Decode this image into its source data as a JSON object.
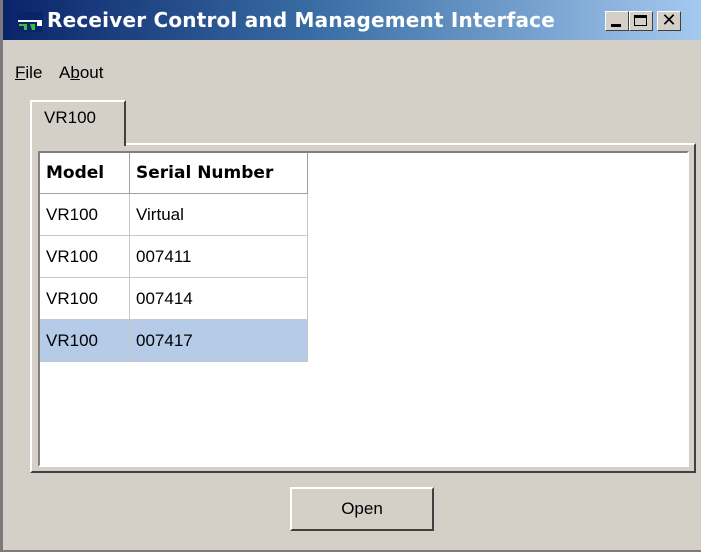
{
  "window": {
    "title": "Receiver Control and Management Interface",
    "icon": "app-icon"
  },
  "menubar": {
    "file": {
      "first": "F",
      "rest": "ile"
    },
    "about": {
      "first": "A",
      "underline": "b",
      "rest": "out"
    }
  },
  "tabs": [
    {
      "label": "VR100",
      "selected": true
    }
  ],
  "table": {
    "columns": [
      "Model",
      "Serial Number"
    ],
    "rows": [
      {
        "model": "VR100",
        "serial": "Virtual",
        "selected": false
      },
      {
        "model": "VR100",
        "serial": "007411",
        "selected": false
      },
      {
        "model": "VR100",
        "serial": "007414",
        "selected": false
      },
      {
        "model": "VR100",
        "serial": "007417",
        "selected": true
      }
    ]
  },
  "buttons": {
    "open": "Open"
  },
  "colors": {
    "titlebar_start": "#0a246a",
    "titlebar_end": "#a6caf0",
    "selection": "#b6cbe8",
    "face": "#d4d0c8"
  }
}
